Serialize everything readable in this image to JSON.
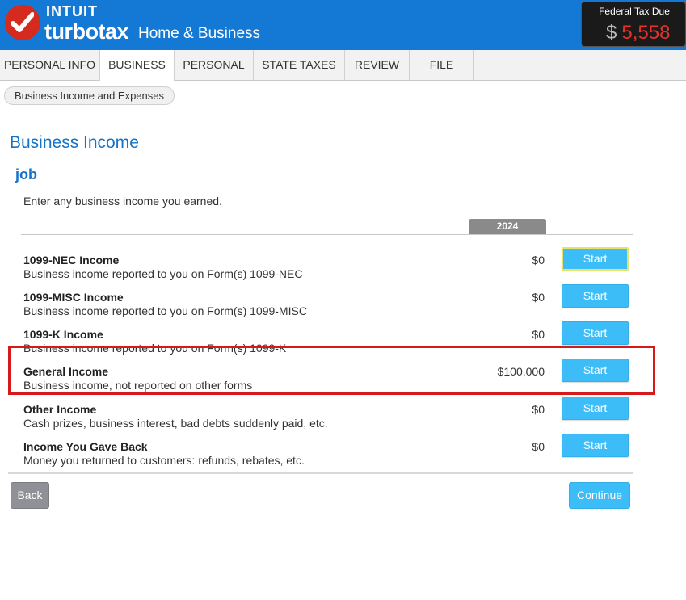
{
  "header": {
    "brand_intuit": "INTUIT",
    "brand_turbotax": "turbotax",
    "brand_product": "Home & Business",
    "logo_icon": "checkmark-icon",
    "tax_due_label": "Federal Tax Due",
    "tax_due_currency": "$",
    "tax_due_amount": "5,558",
    "colors": {
      "header_bg": "#1479d4",
      "logo_red": "#d52b1e",
      "due_red": "#e8302a"
    }
  },
  "tabs": [
    {
      "label": "PERSONAL INFO",
      "active": false
    },
    {
      "label": "BUSINESS",
      "active": true
    },
    {
      "label": "PERSONAL",
      "active": false
    },
    {
      "label": "STATE TAXES",
      "active": false
    },
    {
      "label": "REVIEW",
      "active": false
    },
    {
      "label": "FILE",
      "active": false
    }
  ],
  "breadcrumb": {
    "label": "Business Income and Expenses"
  },
  "main": {
    "page_title": "Business Income",
    "section_title": "job",
    "intro": "Enter any business income you earned.",
    "year": "2024",
    "start_label": "Start",
    "rows": [
      {
        "title": "1099-NEC Income",
        "desc": "Business income reported to you on Form(s) 1099-NEC",
        "amount": "$0"
      },
      {
        "title": "1099-MISC Income",
        "desc": "Business income reported to you on Form(s) 1099-MISC",
        "amount": "$0"
      },
      {
        "title": "1099-K Income",
        "desc": "Business income reported to you on Form(s) 1099-K",
        "amount": "$0"
      },
      {
        "title": "General Income",
        "desc": "Business income, not reported on other forms",
        "amount": "$100,000"
      },
      {
        "title": "Other Income",
        "desc": "Cash prizes, business interest, bad debts suddenly paid, etc.",
        "amount": "$0"
      },
      {
        "title": "Income You Gave Back",
        "desc": "Money you returned to customers: refunds, rebates, etc.",
        "amount": "$0"
      }
    ],
    "accent_color": "#3cbdf7",
    "highlight_color": "#d61a1a"
  },
  "footer": {
    "back_label": "Back",
    "continue_label": "Continue"
  }
}
